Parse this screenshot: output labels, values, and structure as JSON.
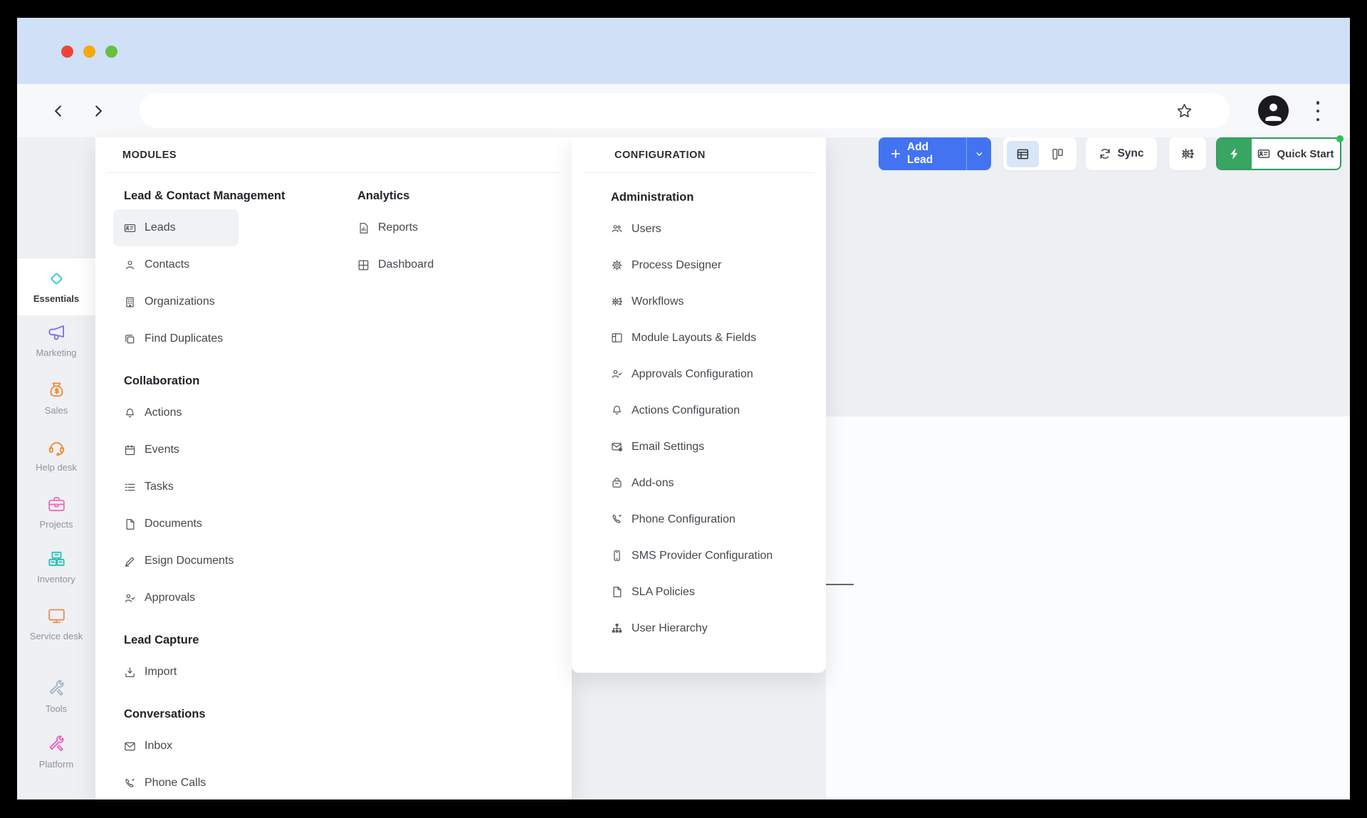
{
  "window": {
    "traffic_lights": {
      "close": "#ee4437",
      "minimize": "#f7a70a",
      "zoom": "#67bf3f"
    },
    "title_bar_color": "#cfe0f7"
  },
  "browser": {
    "address_value": ""
  },
  "sidebar": {
    "items": [
      {
        "label": "Essentials",
        "icon": "diamond",
        "color": "#27c8d0",
        "active": true
      },
      {
        "label": "Marketing",
        "icon": "megaphone",
        "color": "#7d6cf0",
        "active": false
      },
      {
        "label": "Sales",
        "icon": "money-bag",
        "color": "#f08a2e",
        "active": false
      },
      {
        "label": "Help desk",
        "icon": "headset",
        "color": "#f08a2e",
        "active": false
      },
      {
        "label": "Projects",
        "icon": "briefcase",
        "color": "#ea6fb8",
        "active": false
      },
      {
        "label": "Inventory",
        "icon": "storage",
        "color": "#21c3b9",
        "active": false
      },
      {
        "label": "Service desk",
        "icon": "monitor",
        "color": "#ef8a50",
        "active": false
      },
      {
        "label": "Tools",
        "icon": "tools",
        "color": "#a3b3c4",
        "active": false
      },
      {
        "label": "Platform",
        "icon": "tools",
        "color": "#ef59c5",
        "active": false
      }
    ]
  },
  "mega_menu": {
    "modules": {
      "header": "MODULES",
      "column1": {
        "sections": [
          {
            "heading": "Lead & Contact Management",
            "items": [
              {
                "label": "Leads",
                "icon": "id-card",
                "active": true
              },
              {
                "label": "Contacts",
                "icon": "user",
                "active": false
              },
              {
                "label": "Organizations",
                "icon": "building",
                "active": false
              },
              {
                "label": "Find Duplicates",
                "icon": "copy",
                "active": false
              }
            ]
          },
          {
            "heading": "Collaboration",
            "items": [
              {
                "label": "Actions",
                "icon": "bell",
                "active": false
              },
              {
                "label": "Events",
                "icon": "calendar",
                "active": false
              },
              {
                "label": "Tasks",
                "icon": "task-list",
                "active": false
              },
              {
                "label": "Documents",
                "icon": "doc",
                "active": false
              },
              {
                "label": "Esign Documents",
                "icon": "pen",
                "active": false
              },
              {
                "label": "Approvals",
                "icon": "user-check",
                "active": false
              }
            ]
          },
          {
            "heading": "Lead Capture",
            "items": [
              {
                "label": "Import",
                "icon": "import",
                "active": false
              }
            ]
          },
          {
            "heading": "Conversations",
            "items": [
              {
                "label": "Inbox",
                "icon": "mail",
                "active": false
              },
              {
                "label": "Phone Calls",
                "icon": "phone",
                "active": false
              }
            ]
          }
        ]
      },
      "column2": {
        "sections": [
          {
            "heading": "Analytics",
            "items": [
              {
                "label": "Reports",
                "icon": "report",
                "active": false
              },
              {
                "label": "Dashboard",
                "icon": "grid",
                "active": false
              }
            ]
          }
        ]
      }
    },
    "configuration": {
      "header": "CONFIGURATION",
      "sections": [
        {
          "heading": "Administration",
          "items": [
            {
              "label": "Users",
              "icon": "users",
              "active": false
            },
            {
              "label": "Process Designer",
              "icon": "gear",
              "active": false
            },
            {
              "label": "Workflows",
              "icon": "gears",
              "active": false
            },
            {
              "label": "Module Layouts & Fields",
              "icon": "layout",
              "active": false
            },
            {
              "label": "Approvals Configuration",
              "icon": "user-check",
              "active": false
            },
            {
              "label": "Actions Configuration",
              "icon": "bell",
              "active": false
            },
            {
              "label": "Email Settings",
              "icon": "mail-gear",
              "active": false
            },
            {
              "label": "Add-ons",
              "icon": "bag",
              "active": false
            },
            {
              "label": "Phone Configuration",
              "icon": "phone",
              "active": false
            },
            {
              "label": "SMS Provider Configuration",
              "icon": "mobile",
              "active": false
            },
            {
              "label": "SLA Policies",
              "icon": "doc",
              "active": false
            },
            {
              "label": "User Hierarchy",
              "icon": "sitemap",
              "active": false
            }
          ]
        }
      ]
    }
  },
  "action_bar": {
    "add_lead_label": "Add Lead",
    "sync_label": "Sync",
    "quick_start_label": "Quick Start",
    "colors": {
      "add_lead": "#4273f0",
      "quick_start_green": "#38a662",
      "selected_toggle": "#d8e6f8"
    }
  }
}
